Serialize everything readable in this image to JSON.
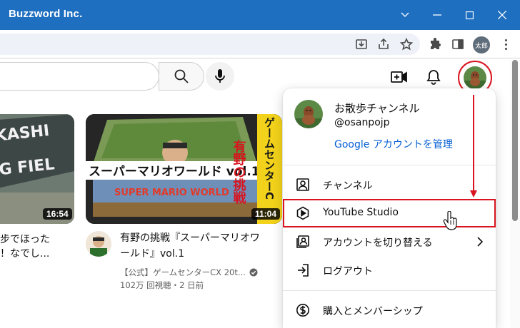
{
  "window": {
    "title": "Buzzword Inc."
  },
  "browser": {
    "profile_label": "太郎"
  },
  "videos": [
    {
      "thumb_text_line1": "AKASHI",
      "thumb_text_line2": "ING FIEL",
      "duration": "16:54",
      "title_line1": "步でほった",
      "title_line2": "！なでし..."
    },
    {
      "thumb_banner": "スーパーマリオワールド vol.1",
      "thumb_side_text": "有野の挑戦",
      "thumb_vertical_text": "ゲームセンターC",
      "thumb_logo": "SUPER MARIO WORLD",
      "duration": "11:04",
      "title_line1": "有野の挑戦『スーパーマリオワ",
      "title_line2": "ールド』vol.1",
      "channel": "【公式】ゲームセンターCX 20t...",
      "stats": "102万 回視聴・2 日前"
    }
  ],
  "account_menu": {
    "name": "お散歩チャンネル",
    "handle": "@osanpojp",
    "manage_link": "Google アカウントを管理",
    "items": [
      {
        "label": "チャンネル",
        "icon": "person-box-icon"
      },
      {
        "label": "YouTube Studio",
        "icon": "studio-play-icon"
      },
      {
        "label": "アカウントを切り替える",
        "icon": "switch-account-icon"
      },
      {
        "label": "ログアウト",
        "icon": "logout-icon"
      },
      {
        "label": "購入とメンバーシップ",
        "icon": "dollar-circle-icon"
      }
    ]
  },
  "colors": {
    "titlebar": "#1f6fc1",
    "annotation_red": "#d9141e",
    "link_blue": "#065fd4"
  }
}
